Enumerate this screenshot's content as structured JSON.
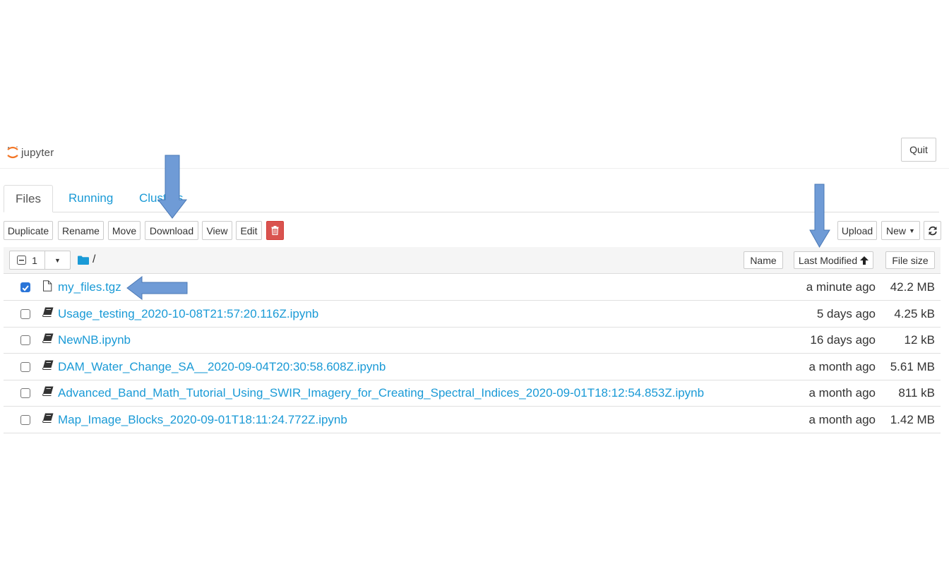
{
  "header": {
    "logo_text": "jupyter",
    "quit_label": "Quit"
  },
  "tabs": [
    {
      "label": "Files"
    },
    {
      "label": "Running"
    },
    {
      "label": "Clusters"
    }
  ],
  "toolbar": {
    "duplicate": "Duplicate",
    "rename": "Rename",
    "move": "Move",
    "download": "Download",
    "view": "View",
    "edit": "Edit",
    "delete_icon": "trash-icon",
    "upload": "Upload",
    "new": "New",
    "refresh_icon": "refresh-icon"
  },
  "list_header": {
    "selected_count": "1",
    "breadcrumb": "/",
    "sort_name": "Name",
    "sort_last_modified": "Last Modified",
    "sort_file_size": "File size"
  },
  "files": [
    {
      "name": "my_files.tgz",
      "modified": "a minute ago",
      "size": "42.2 MB",
      "checked": true,
      "icon": "file-icon"
    },
    {
      "name": "Usage_testing_2020-10-08T21:57:20.116Z.ipynb",
      "modified": "5 days ago",
      "size": "4.25 kB",
      "checked": false,
      "icon": "notebook-icon"
    },
    {
      "name": "NewNB.ipynb",
      "modified": "16 days ago",
      "size": "12 kB",
      "checked": false,
      "icon": "notebook-icon"
    },
    {
      "name": "DAM_Water_Change_SA__2020-09-04T20:30:58.608Z.ipynb",
      "modified": "a month ago",
      "size": "5.61 MB",
      "checked": false,
      "icon": "notebook-icon"
    },
    {
      "name": "Advanced_Band_Math_Tutorial_Using_SWIR_Imagery_for_Creating_Spectral_Indices_2020-09-01T18:12:54.853Z.ipynb",
      "modified": "a month ago",
      "size": "811 kB",
      "checked": false,
      "icon": "notebook-icon"
    },
    {
      "name": "Map_Image_Blocks_2020-09-01T18:11:24.772Z.ipynb",
      "modified": "a month ago",
      "size": "1.42 MB",
      "checked": false,
      "icon": "notebook-icon"
    }
  ],
  "colors": {
    "link": "#1a9ad6",
    "danger": "#d9534f",
    "annotation_arrow": "#6f9bd6",
    "logo_orange": "#f37626"
  }
}
